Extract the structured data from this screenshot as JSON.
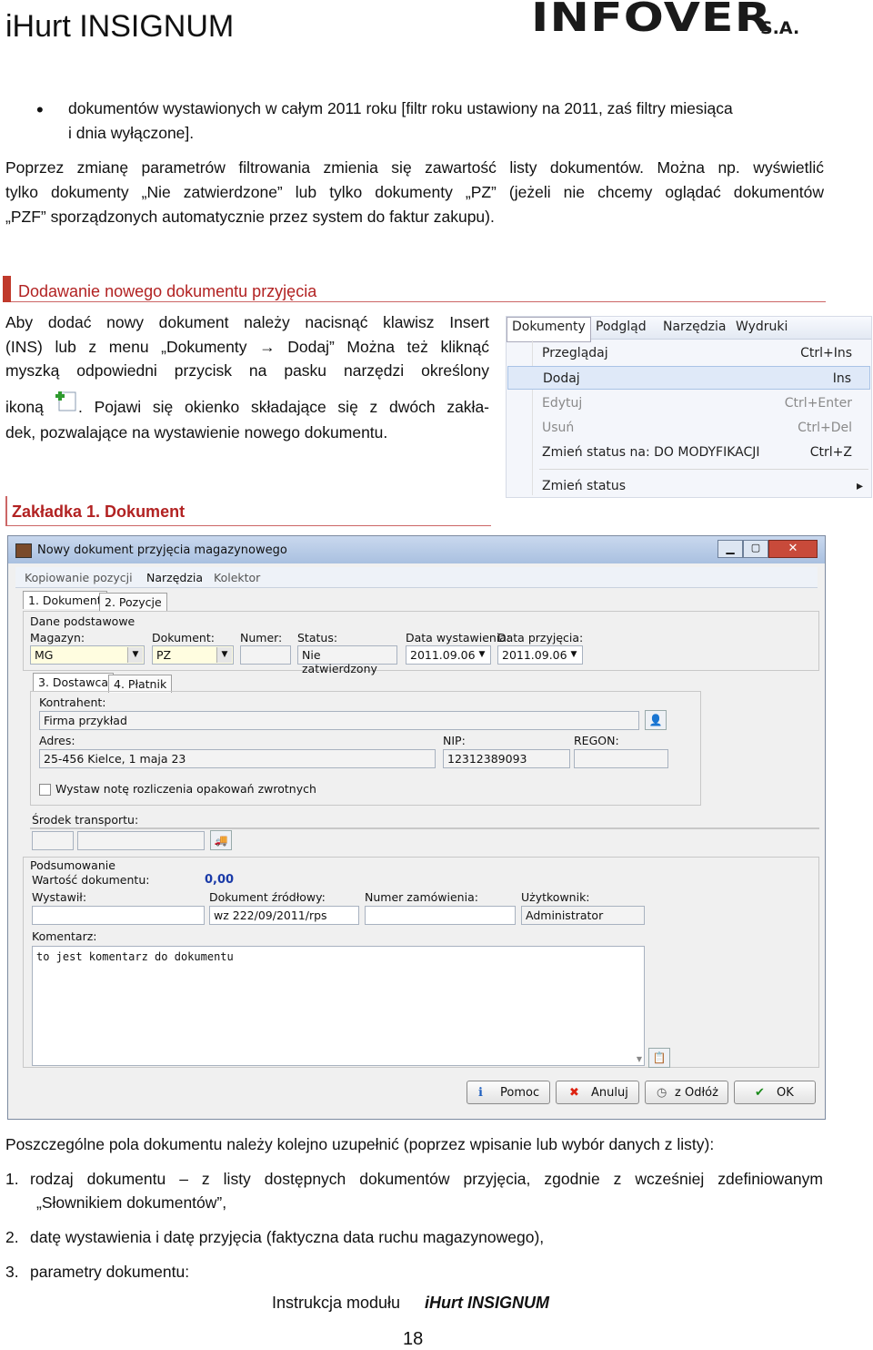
{
  "header": {
    "title": "iHurt INSIGNUM",
    "logo_text": "INFOVER",
    "logo_suffix": "S.A."
  },
  "bullet_line1": "dokumentów wystawionych w całym 2011 roku [filtr roku ustawiony na 2011, zaś filtry miesiąca",
  "bullet_line2": "i dnia wyłączone].",
  "para1_line1": "Poprzez zmianę parametrów filtrowania zmienia się zawartość listy dokumentów. Można np. wyświetlić",
  "para1_line2": "tylko dokumenty „Nie zatwierdzone” lub tylko dokumenty „PZ” (jeżeli nie chcemy oglądać dokumentów",
  "para1_line3": "„PZF” sporządzonych automatycznie przez system do faktur zakupu).",
  "section1_title": "Dodawanie nowego dokumentu przyjęcia",
  "s1_line1": "Aby dodać nowy dokument należy nacisnąć klawisz Insert",
  "s1_line2": "(INS) lub z menu „Dokumenty → Dodaj” Można też kliknąć",
  "s1_line3": "myszką odpowiedni przycisk na pasku narzędzi określony",
  "s1_line4a": "ikoną",
  "s1_line4b": ". Pojawi się okienko składające się z dwóch zakła-",
  "s1_line5": "dek, pozwalające na wystawienie nowego dokumentu.",
  "menu": {
    "bar": [
      "Dokumenty",
      "Podgląd",
      "Narzędzia",
      "Wydruki"
    ],
    "items": [
      {
        "label": "Przeglądaj",
        "shortcut": "Ctrl+Ins"
      },
      {
        "label": "Dodaj",
        "shortcut": "Ins"
      },
      {
        "label": "Edytuj",
        "shortcut": "Ctrl+Enter"
      },
      {
        "label": "Usuń",
        "shortcut": "Ctrl+Del"
      },
      {
        "label": "Zmień status na: DO MODYFIKACJI",
        "shortcut": "Ctrl+Z"
      },
      {
        "label": "Zmień status",
        "shortcut": ""
      }
    ]
  },
  "section2_title": "Zakładka 1. Dokument",
  "window": {
    "title": "Nowy dokument przyjęcia magazynowego",
    "toolbar": [
      "Kopiowanie pozycji",
      "Narzędzia",
      "Kolektor"
    ],
    "tabs": [
      "1. Dokument",
      "2. Pozycje"
    ],
    "group_basic": "Dane podstawowe",
    "labels": {
      "magazyn": "Magazyn:",
      "dokument": "Dokument:",
      "numer": "Numer:",
      "status": "Status:",
      "data_wyst": "Data wystawienia:",
      "data_przyj": "Data przyjęcia:",
      "kontrahent": "Kontrahent:",
      "adres": "Adres:",
      "nip": "NIP:",
      "regon": "REGON:",
      "checkbox": "Wystaw notę rozliczenia opakowań zwrotnych",
      "srodek": "Środek transportu:",
      "podsumowanie": "Podsumowanie",
      "wartosc": "Wartość dokumentu:",
      "wystawil": "Wystawił:",
      "dok_zrodlowy": "Dokument źródłowy:",
      "nr_zamowienia": "Numer zamówienia:",
      "uzytkownik": "Użytkownik:",
      "komentarz": "Komentarz:"
    },
    "subtabs": [
      "3. Dostawca",
      "4. Płatnik"
    ],
    "values": {
      "magazyn": "MG",
      "dokument": "PZ",
      "status": "Nie zatwierdzony",
      "data_wyst": "2011.09.06",
      "data_przyj": "2011.09.06",
      "kontrahent": "Firma przykład",
      "adres": "25-456 Kielce, 1 maja 23",
      "nip": "12312389093",
      "wartosc": "0,00",
      "dok_zrodlowy": "wz 222/09/2011/rps",
      "uzytkownik": "Administrator",
      "komentarz": "to jest komentarz do dokumentu"
    },
    "buttons": [
      "Pomoc",
      "Anuluj",
      "z Odłóż",
      "OK"
    ]
  },
  "para2": "Poszczególne pola dokumentu należy kolejno uzupełnić (poprzez wpisanie lub wybór danych z listy):",
  "list": [
    {
      "num": "1.",
      "line1": "rodzaj dokumentu – z listy dostępnych dokumentów przyjęcia, zgodnie z wcześniej zdefiniowanym",
      "line2": "„Słownikiem dokumentów”,"
    },
    {
      "num": "2.",
      "line1": "datę wystawienia i datę przyjęcia (faktyczna data ruchu magazynowego),",
      "line2": ""
    },
    {
      "num": "3.",
      "line1": "parametry dokumentu:",
      "line2": ""
    }
  ],
  "footer": {
    "text": "Instrukcja modułu",
    "product": "iHurt INSIGNUM",
    "page": "18"
  }
}
